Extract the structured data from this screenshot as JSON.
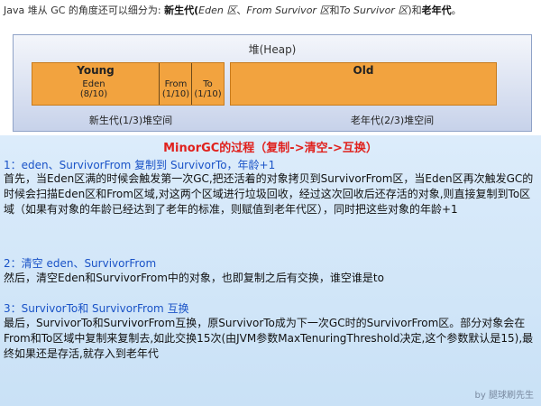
{
  "intro": {
    "prefix": "Java 堆从 GC 的角度还可以细分为:",
    "young_gen_label": "新生代",
    "eden_area": "Eden 区",
    "sep1": "、",
    "from_area": "From Survivor 区",
    "conj": "和",
    "to_area": "To Survivor 区",
    "suffix1": ")和",
    "old_gen_label": "老年代",
    "end_mark": "。",
    "open_paren": "("
  },
  "diagram": {
    "heap_label": "堆(Heap)",
    "young_title": "Young",
    "eden_name": "Eden",
    "eden_ratio": "(8/10)",
    "from_name": "From",
    "from_ratio": "(1/10)",
    "to_name": "To",
    "to_ratio": "(1/10)",
    "old_title": "Old",
    "young_caption": "新生代(1/3)堆空间",
    "old_caption": "老年代(2/3)堆空间"
  },
  "explanation": {
    "heading": "MinorGC的过程（复制->清空->互换）",
    "step1_title": "1：eden、SurvivorFrom 复制到 SurvivorTo，年龄+1",
    "step1_body": "首先，当Eden区满的时候会触发第一次GC,把还活着的对象拷贝到SurvivorFrom区，当Eden区再次触发GC的时候会扫描Eden区和From区域,对这两个区域进行垃圾回收，经过这次回收后还存活的对象,则直接复制到To区域（如果有对象的年龄已经达到了老年的标准，则赋值到老年代区），同时把这些对象的年龄+1",
    "step2_title": "2：清空 eden、SurvivorFrom",
    "step2_body": "然后，清空Eden和SurvivorFrom中的对象，也即复制之后有交换，谁空谁是to",
    "step3_title": "3：SurvivorTo和 SurvivorFrom 互换",
    "step3_body": "最后，SurvivorTo和SurvivorFrom互换，原SurvivorTo成为下一次GC时的SurvivorFrom区。部分对象会在From和To区域中复制来复制去,如此交换15次(由JVM参数MaxTenuringThreshold决定,这个参数默认是15),最终如果还是存活,就存入到老年代",
    "watermark": "by 腿球刷先生"
  },
  "colors": {
    "orange": "#f2a33f",
    "heading_red": "#e0211d",
    "step_blue": "#1a53c7",
    "panel_blue": "#dcecfb"
  }
}
